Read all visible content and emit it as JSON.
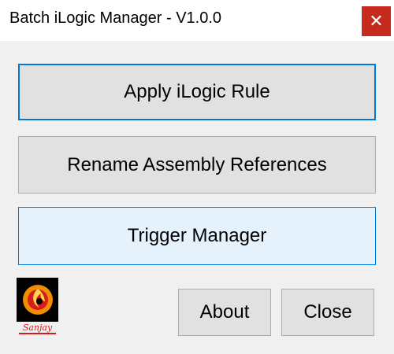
{
  "window": {
    "title": "Batch iLogic Manager - V1.0.0",
    "close_glyph": "✕"
  },
  "buttons": {
    "apply": "Apply iLogic Rule",
    "rename": "Rename Assembly References",
    "trigger": "Trigger Manager",
    "about": "About",
    "close": "Close"
  },
  "logo": {
    "text": "Sanjay"
  },
  "colors": {
    "titlebar_close": "#c42b1c",
    "focus_border": "#0078d7",
    "hover_fill": "#e5f1fb",
    "button_fill": "#e1e1e1",
    "client_bg": "#f0f0f0"
  }
}
